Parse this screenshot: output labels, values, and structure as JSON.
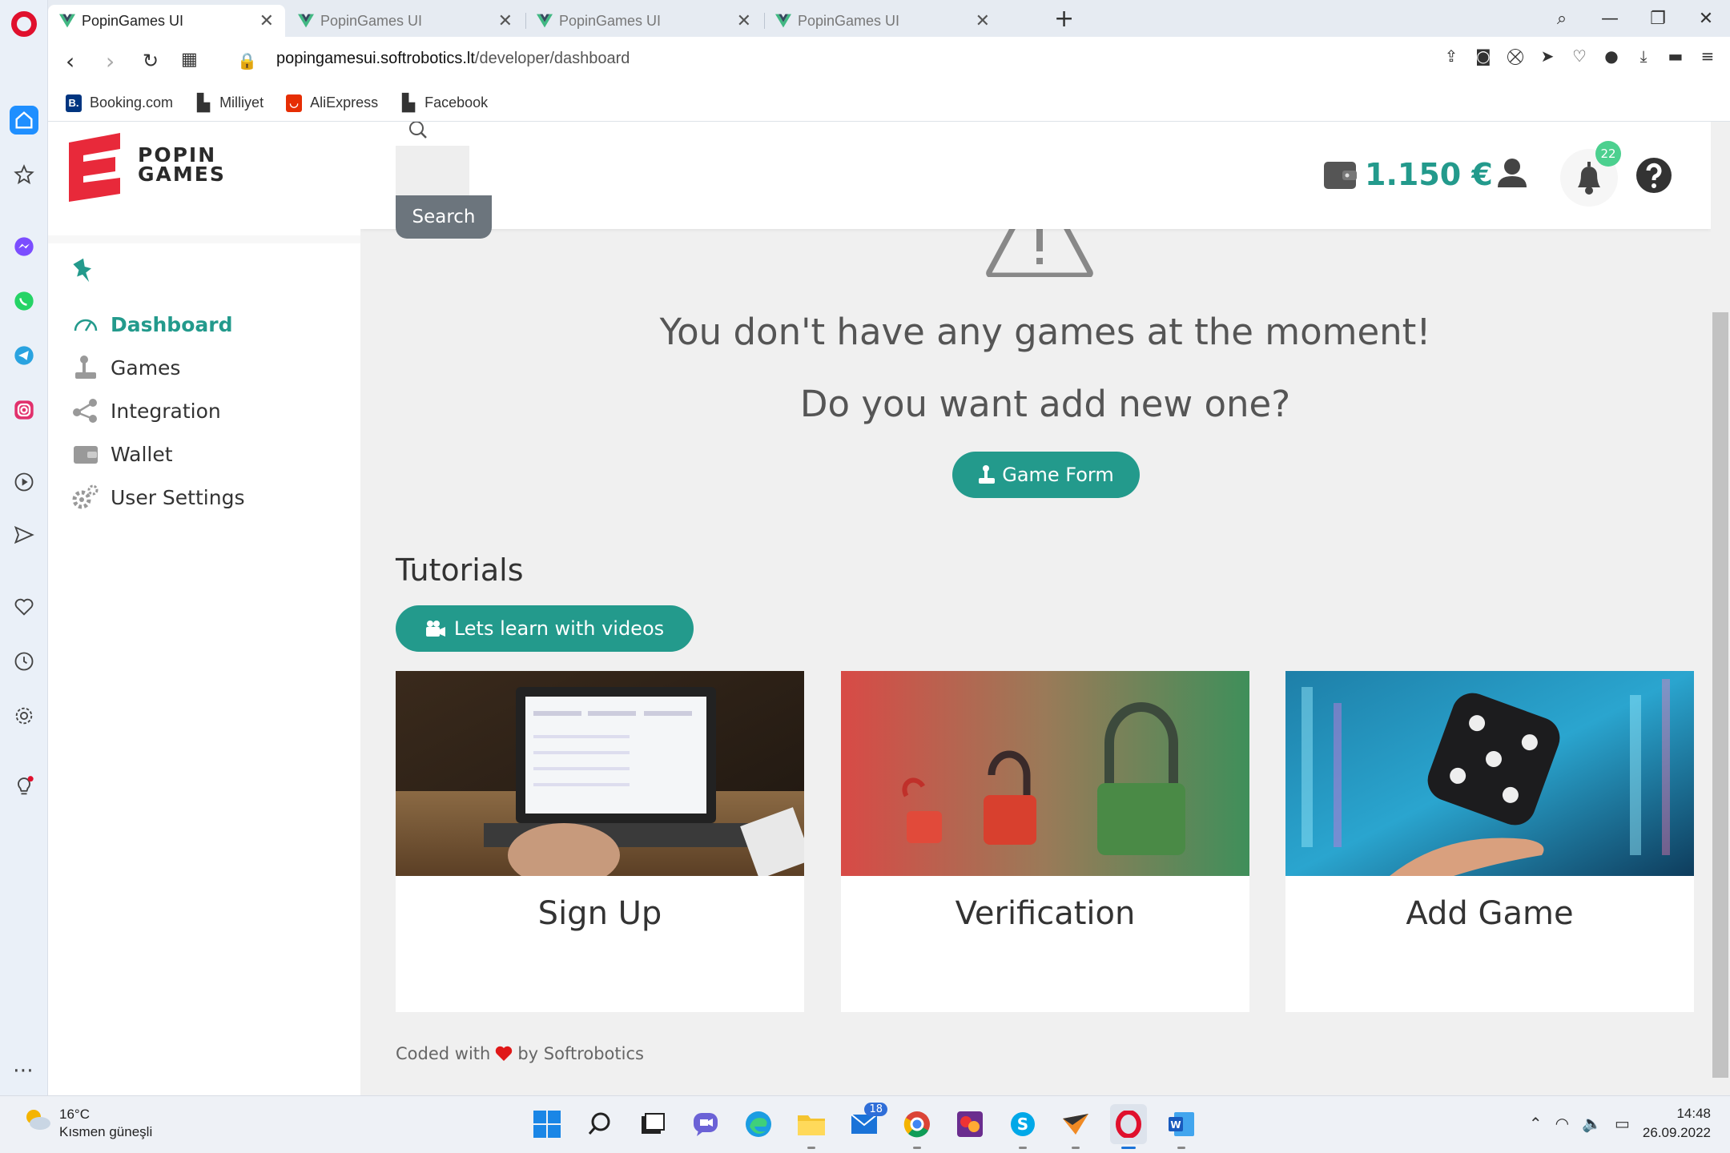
{
  "browser": {
    "tabs": [
      {
        "title": "PopinGames UI",
        "active": true
      },
      {
        "title": "PopinGames UI",
        "active": false
      },
      {
        "title": "PopinGames UI",
        "active": false
      },
      {
        "title": "PopinGames UI",
        "active": false
      }
    ],
    "url_host": "popingamesui.softrobotics.lt",
    "url_path": "/developer/dashboard",
    "bookmarks": [
      {
        "label": "Booking.com",
        "icon": "booking-icon"
      },
      {
        "label": "Milliyet",
        "icon": "page-icon"
      },
      {
        "label": "AliExpress",
        "icon": "aliexpress-icon"
      },
      {
        "label": "Facebook",
        "icon": "page-icon"
      }
    ]
  },
  "app": {
    "brand": {
      "line1": "POPIN",
      "line2": "GAMES",
      "accent": "#e8293a"
    },
    "accent_color": "#239a8c",
    "menu": [
      {
        "label": "Dashboard",
        "icon": "speedometer-icon",
        "active": true
      },
      {
        "label": "Games",
        "icon": "joystick-icon",
        "active": false
      },
      {
        "label": "Integration",
        "icon": "share-nodes-icon",
        "active": false
      },
      {
        "label": "Wallet",
        "icon": "wallet-icon",
        "active": false
      },
      {
        "label": "User Settings",
        "icon": "gears-icon",
        "active": false
      }
    ],
    "header": {
      "search_button": "Search",
      "wallet_amount": "1.150 €",
      "notification_count": "22"
    },
    "empty_state": {
      "title": "You don't have any games at the moment!",
      "subtitle": "Do you want add new one?",
      "button": "Game Form"
    },
    "tutorials": {
      "title": "Tutorials",
      "button": "Lets learn with videos",
      "cards": [
        {
          "title": "Sign Up"
        },
        {
          "title": "Verification"
        },
        {
          "title": "Add Game"
        }
      ]
    },
    "footer": {
      "prefix": "Coded with",
      "suffix": "by Softrobotics"
    }
  },
  "taskbar": {
    "weather_temp": "16°C",
    "weather_desc": "Kısmen güneşli",
    "time": "14:48",
    "date": "26.09.2022",
    "mail_badge": "18"
  }
}
